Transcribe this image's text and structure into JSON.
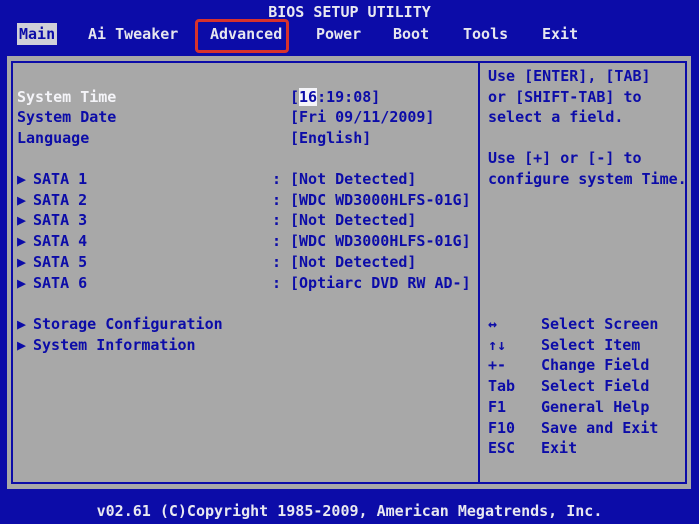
{
  "title": "BIOS SETUP UTILITY",
  "menu": [
    {
      "label": "Main"
    },
    {
      "label": "Ai Tweaker"
    },
    {
      "label": "Advanced"
    },
    {
      "label": "Power"
    },
    {
      "label": "Boot"
    },
    {
      "label": "Tools"
    },
    {
      "label": "Exit"
    }
  ],
  "settings": {
    "system_time_label": "System Time",
    "system_time_prefix": "[",
    "system_time_hour": "16",
    "system_time_rest": ":19:08]",
    "system_date_label": "System Date",
    "system_date_value": "[Fri 09/11/2009]",
    "language_label": "Language",
    "language_value": "[English]"
  },
  "sata": [
    {
      "label": "SATA 1",
      "value": "[Not Detected]"
    },
    {
      "label": "SATA 2",
      "value": "[WDC WD3000HLFS-01G]"
    },
    {
      "label": "SATA 3",
      "value": "[Not Detected]"
    },
    {
      "label": "SATA 4",
      "value": "[WDC WD3000HLFS-01G]"
    },
    {
      "label": "SATA 5",
      "value": "[Not Detected]"
    },
    {
      "label": "SATA 6",
      "value": "[Optiarc DVD RW AD-]"
    }
  ],
  "submenus": [
    {
      "label": "Storage Configuration"
    },
    {
      "label": "System Information"
    }
  ],
  "help_text": [
    "Use [ENTER], [TAB]",
    "or [SHIFT-TAB] to",
    "select a field.",
    "",
    "Use [+] or [-] to",
    "configure system Time."
  ],
  "keys": [
    {
      "key": "↔",
      "desc": "Select Screen"
    },
    {
      "key": "↑↓",
      "desc": "Select Item"
    },
    {
      "key": "+-",
      "desc": "Change Field"
    },
    {
      "key": "Tab",
      "desc": "Select Field"
    },
    {
      "key": "F1",
      "desc": "General Help"
    },
    {
      "key": "F10",
      "desc": "Save and Exit"
    },
    {
      "key": "ESC",
      "desc": "Exit"
    }
  ],
  "footer": "v02.61 (C)Copyright 1985-2009, American Megatrends, Inc.",
  "colors": {
    "background_blue": "#0c0ca8",
    "panel_gray": "#a8a8a8",
    "highlight_red": "#d8322c"
  }
}
